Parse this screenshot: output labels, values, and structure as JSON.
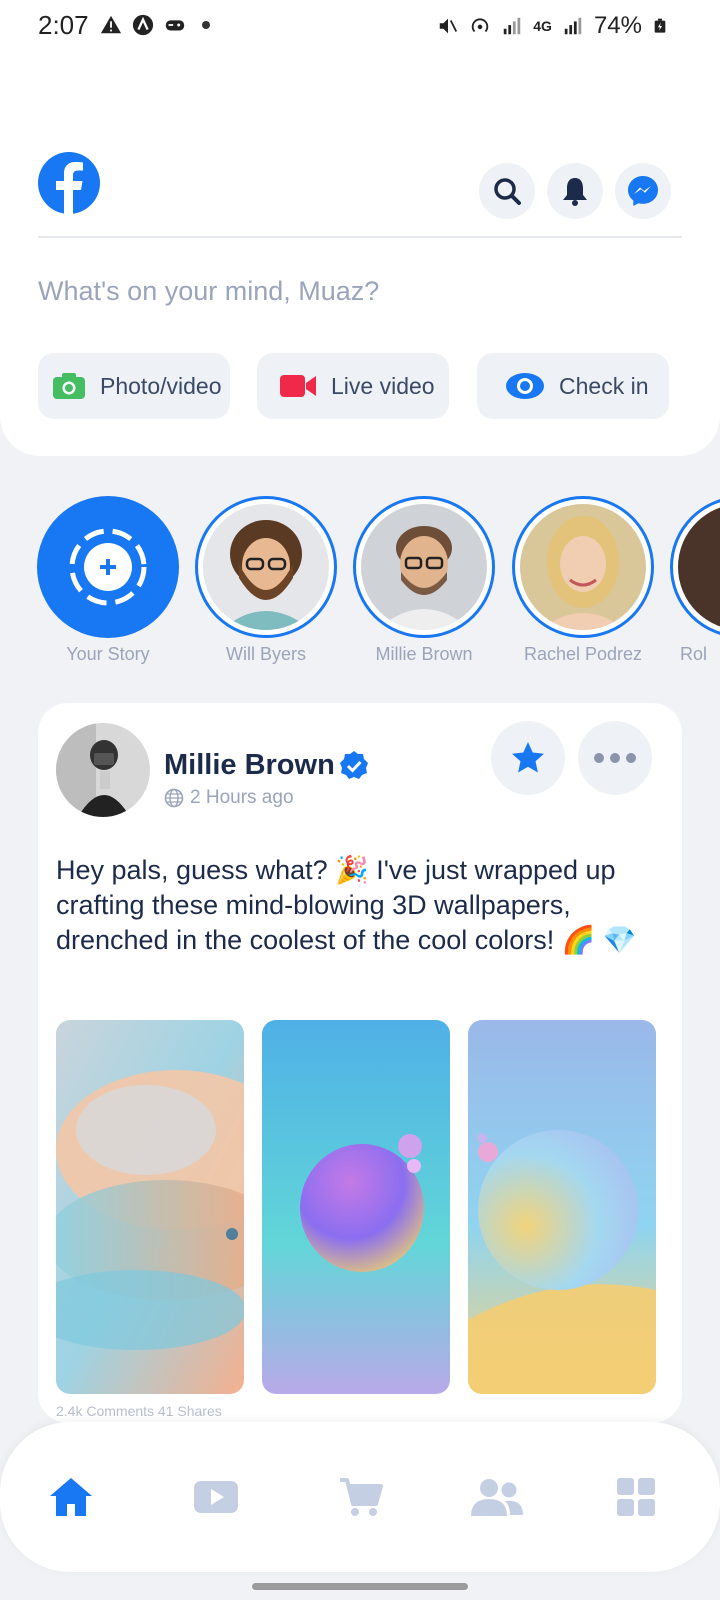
{
  "status_bar": {
    "time": "2:07",
    "battery": "74%",
    "network": "4G"
  },
  "header": {
    "composer_placeholder": "What's on your mind, Muaz?",
    "actions": [
      {
        "label": "Photo/video",
        "icon": "photo-icon",
        "color": "#45bd62"
      },
      {
        "label": "Live video",
        "icon": "video-camera-icon",
        "color": "#f02849"
      },
      {
        "label": "Check in",
        "icon": "eye-icon",
        "color": "#1877f2"
      }
    ]
  },
  "stories": [
    {
      "label": "Your Story"
    },
    {
      "label": "Will Byers"
    },
    {
      "label": "Millie Brown"
    },
    {
      "label": "Rachel Podrez"
    },
    {
      "label": "Rol"
    }
  ],
  "post": {
    "author": "Millie Brown",
    "time": "2 Hours ago",
    "text": "Hey pals, guess what? 🎉 I've just wrapped up crafting these mind-blowing 3D wallpapers, drenched in the coolest of the cool colors! 🌈 💎",
    "stats": "2.4k Comments  41 Shares"
  },
  "colors": {
    "brand": "#1877f2",
    "muted": "#9aa4bb",
    "text": "#1c2b4a"
  },
  "nav": [
    "home-icon",
    "video-icon",
    "cart-icon",
    "friends-icon",
    "menu-grid-icon"
  ]
}
